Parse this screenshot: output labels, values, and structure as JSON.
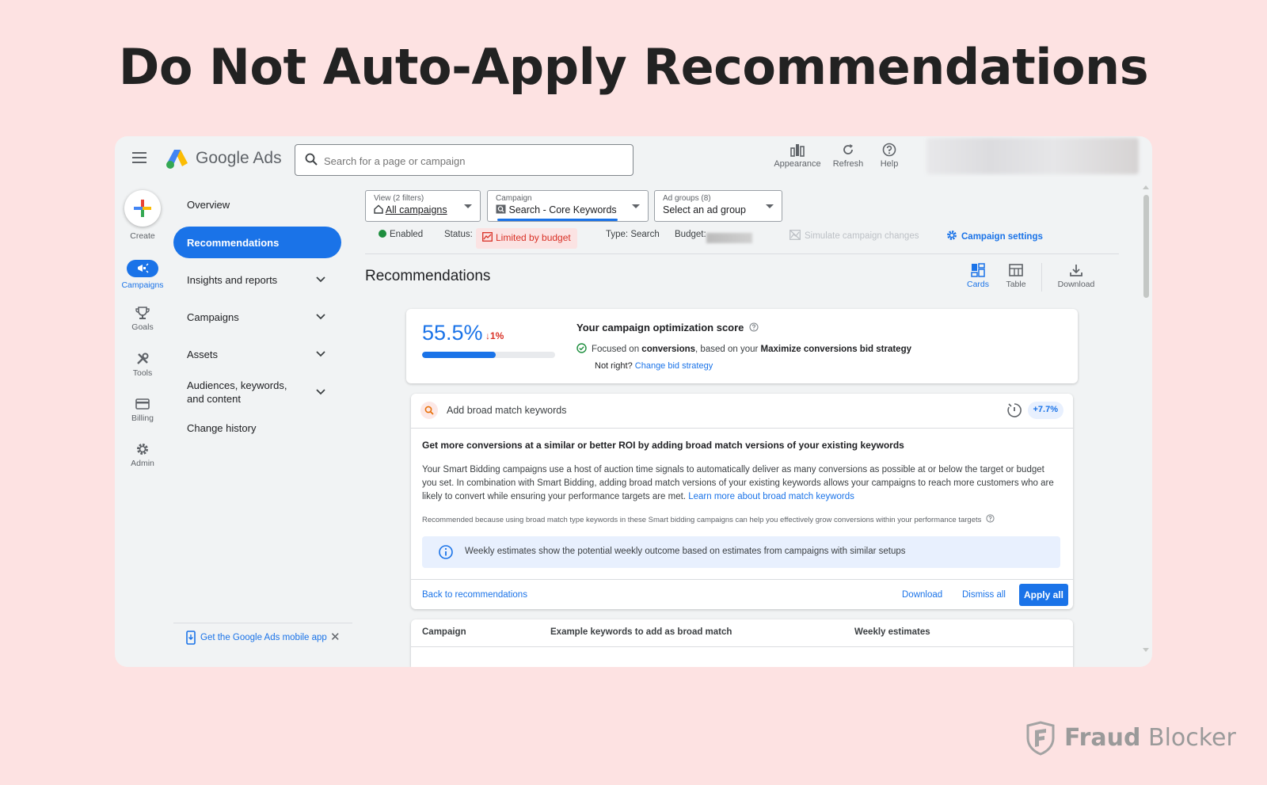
{
  "headline": "Do Not Auto-Apply Recommendations",
  "topbar": {
    "brand": "Google Ads",
    "search_placeholder": "Search for a page or campaign",
    "appearance_label": "Appearance",
    "refresh_label": "Refresh",
    "help_label": "Help"
  },
  "rail": {
    "create": "Create",
    "campaigns": "Campaigns",
    "goals": "Goals",
    "tools": "Tools",
    "billing": "Billing",
    "admin": "Admin"
  },
  "nav": {
    "items": [
      "Overview",
      "Recommendations",
      "Insights and reports",
      "Campaigns",
      "Assets",
      "Audiences, keywords, and content",
      "Change history"
    ],
    "mobile_app": "Get the Google Ads mobile app",
    "close": "✕"
  },
  "filters": {
    "view_label": "View (2 filters)",
    "view_value": "All campaigns",
    "campaign_label": "Campaign",
    "campaign_value": "Search - Core Keywords",
    "adgroups_label": "Ad groups (8)",
    "adgroups_value": "Select an ad group"
  },
  "status": {
    "enabled": "Enabled",
    "status_label": "Status:",
    "status_value": "Limited by budget",
    "type": "Type: Search",
    "budget_label": "Budget:",
    "simulate": "Simulate campaign changes",
    "settings": "Campaign settings"
  },
  "section": {
    "title": "Recommendations",
    "cards": "Cards",
    "table": "Table",
    "download": "Download"
  },
  "score": {
    "value": "55.5%",
    "percent": 55.5,
    "delta": "1%",
    "heading": "Your campaign optimization score",
    "focus_prefix": "Focused on ",
    "focus_bold1": "conversions",
    "focus_mid": ", based on your ",
    "focus_bold2": "Maximize conversions bid strategy",
    "not_right": "Not right?",
    "change_link": "Change bid strategy"
  },
  "rec": {
    "title": "Add broad match keywords",
    "uplift": "+7.7%",
    "subhead": "Get more conversions at a similar or better ROI by adding broad match versions of your existing keywords",
    "body": "Your Smart Bidding campaigns use a host of auction time signals to automatically deliver as many conversions as possible at or below the target or budget you set. In combination with Smart Bidding, adding broad match versions of your existing keywords allows your campaigns to reach more customers who are likely to convert while ensuring your performance targets are met.",
    "learn_more": "Learn more about broad match keywords",
    "why": "Recommended because using broad match type keywords in these Smart bidding campaigns can help you effectively grow conversions within your performance targets",
    "info": "Weekly estimates show the potential weekly outcome based on estimates from campaigns with similar setups",
    "back": "Back to recommendations",
    "download": "Download",
    "dismiss": "Dismiss all",
    "apply": "Apply all"
  },
  "table": {
    "col1": "Campaign",
    "col2": "Example keywords to add as broad match",
    "col3": "Weekly estimates"
  },
  "watermark": {
    "bold": "Fraud",
    "rest": " Blocker"
  },
  "colors": {
    "accent": "#1a73e8",
    "background": "#fde2e2",
    "alert": "#d93025",
    "success": "#1e8e3e"
  }
}
